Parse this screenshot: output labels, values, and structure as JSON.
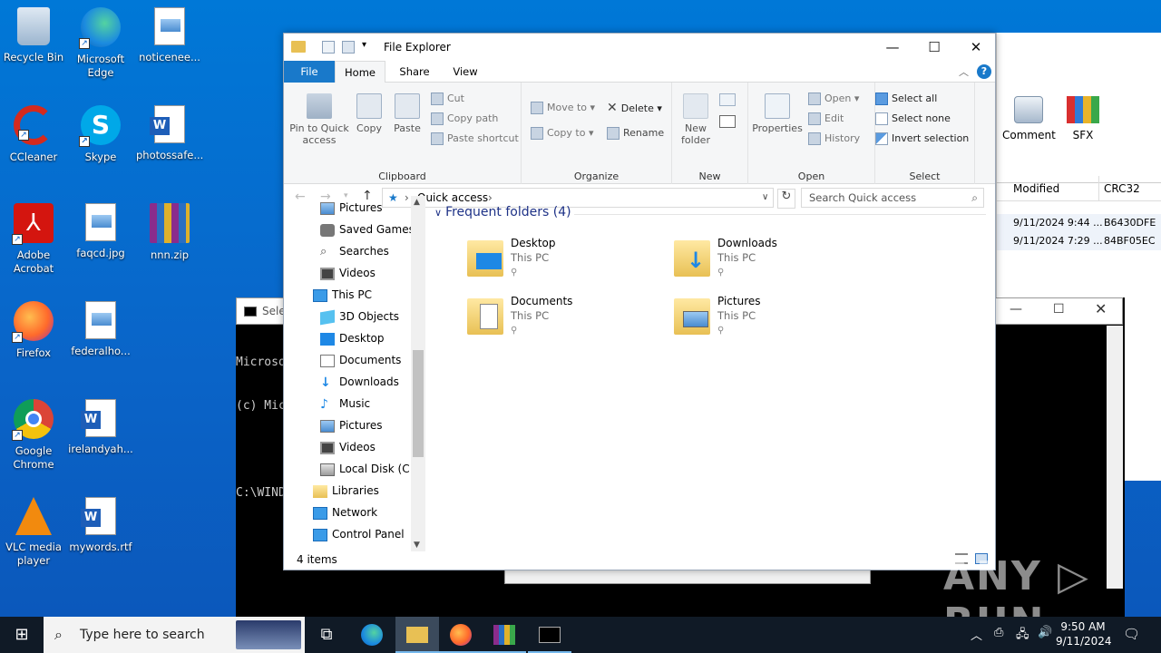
{
  "desktop": {
    "icons": [
      {
        "label": "Recycle Bin"
      },
      {
        "label": "Microsoft Edge"
      },
      {
        "label": "noticenee..."
      },
      {
        "label": "CCleaner"
      },
      {
        "label": "Skype"
      },
      {
        "label": "photossafe..."
      },
      {
        "label": "Adobe Acrobat"
      },
      {
        "label": "faqcd.jpg"
      },
      {
        "label": "nnn.zip"
      },
      {
        "label": "Firefox"
      },
      {
        "label": "federalho..."
      },
      {
        "label": "Google Chrome"
      },
      {
        "label": "irelandyah..."
      },
      {
        "label": "VLC media player"
      },
      {
        "label": "mywords.rtf"
      }
    ]
  },
  "archiver_window": {
    "toolbar": [
      "Comment",
      "SFX"
    ],
    "columns": [
      "Modified",
      "CRC32"
    ],
    "rows": [
      {
        "modified": "9/11/2024 9:44 ...",
        "crc": "B6430DFE"
      },
      {
        "modified": "9/11/2024 7:29 ...",
        "crc": "84BF05EC"
      }
    ]
  },
  "cmd_window": {
    "title": "Selec",
    "lines": [
      "Microso",
      "(c) Mic",
      "",
      "C:\\WIND"
    ]
  },
  "explorer": {
    "title": "File Explorer",
    "tabs": {
      "file": "File",
      "home": "Home",
      "share": "Share",
      "view": "View"
    },
    "ribbon": {
      "clipboard": {
        "pin": "Pin to Quick access",
        "copy": "Copy",
        "paste": "Paste",
        "cut": "Cut",
        "copy_path": "Copy path",
        "paste_shortcut": "Paste shortcut",
        "label": "Clipboard"
      },
      "organize": {
        "move_to": "Move to",
        "copy_to": "Copy to",
        "delete": "Delete",
        "rename": "Rename",
        "label": "Organize"
      },
      "new": {
        "new_folder": "New folder",
        "label": "New"
      },
      "open": {
        "properties": "Properties",
        "open": "Open",
        "edit": "Edit",
        "history": "History",
        "label": "Open"
      },
      "select": {
        "select_all": "Select all",
        "select_none": "Select none",
        "invert": "Invert selection",
        "label": "Select"
      }
    },
    "address": {
      "path": "Quick access",
      "search_placeholder": "Search Quick access"
    },
    "nav_items": [
      {
        "label": "Pictures"
      },
      {
        "label": "Saved Games"
      },
      {
        "label": "Searches"
      },
      {
        "label": "Videos"
      },
      {
        "label": "This PC"
      },
      {
        "label": "3D Objects"
      },
      {
        "label": "Desktop"
      },
      {
        "label": "Documents"
      },
      {
        "label": "Downloads"
      },
      {
        "label": "Music"
      },
      {
        "label": "Pictures"
      },
      {
        "label": "Videos"
      },
      {
        "label": "Local Disk (C:)"
      },
      {
        "label": "Libraries"
      },
      {
        "label": "Network"
      },
      {
        "label": "Control Panel"
      }
    ],
    "section_header": "Frequent folders (4)",
    "folders": [
      {
        "name": "Desktop",
        "location": "This PC"
      },
      {
        "name": "Downloads",
        "location": "This PC"
      },
      {
        "name": "Documents",
        "location": "This PC"
      },
      {
        "name": "Pictures",
        "location": "This PC"
      }
    ],
    "status": "4 items"
  },
  "taskbar": {
    "search_placeholder": "Type here to search",
    "time": "9:50 AM",
    "date": "9/11/2024"
  },
  "watermark": "ANY RUN"
}
